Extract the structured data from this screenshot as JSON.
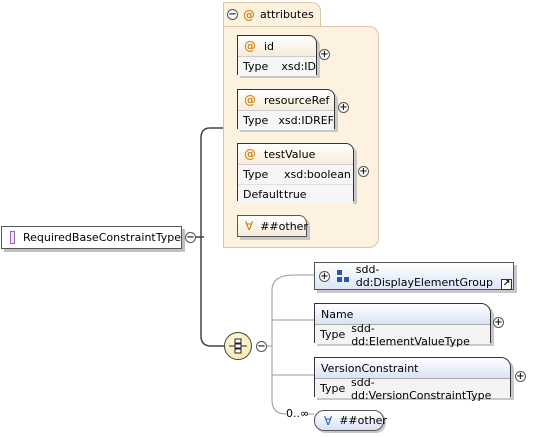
{
  "root": {
    "name": "RequiredBaseConstraintType"
  },
  "attributes_group": {
    "title": "attributes",
    "at_symbol": "@"
  },
  "attributes": [
    {
      "name": "id",
      "rows": [
        {
          "key": "Type",
          "value": "xsd:ID"
        }
      ]
    },
    {
      "name": "resourceRef",
      "rows": [
        {
          "key": "Type",
          "value": "xsd:IDREF"
        }
      ]
    },
    {
      "name": "testValue",
      "rows": [
        {
          "key": "Type",
          "value": "xsd:boolean"
        },
        {
          "key": "Default",
          "value": "true"
        }
      ]
    }
  ],
  "attr_any": {
    "symbol": "∀",
    "label": "##other"
  },
  "group_ref": {
    "name": "sdd-dd:DisplayElementGroup"
  },
  "elements": [
    {
      "name": "Name",
      "type_key": "Type",
      "type_value": "sdd-dd:ElementValueType"
    },
    {
      "name": "VersionConstraint",
      "type_key": "Type",
      "type_value": "sdd-dd:VersionConstraintType"
    }
  ],
  "elem_any": {
    "symbol": "∀",
    "label": "##other",
    "occurrence": "0..∞"
  },
  "controls": {
    "expand": "+",
    "collapse": "−"
  },
  "colors": {
    "attr_bg": "#fdf2df",
    "element_header": "#d8e3f6",
    "lines": "#444444"
  }
}
